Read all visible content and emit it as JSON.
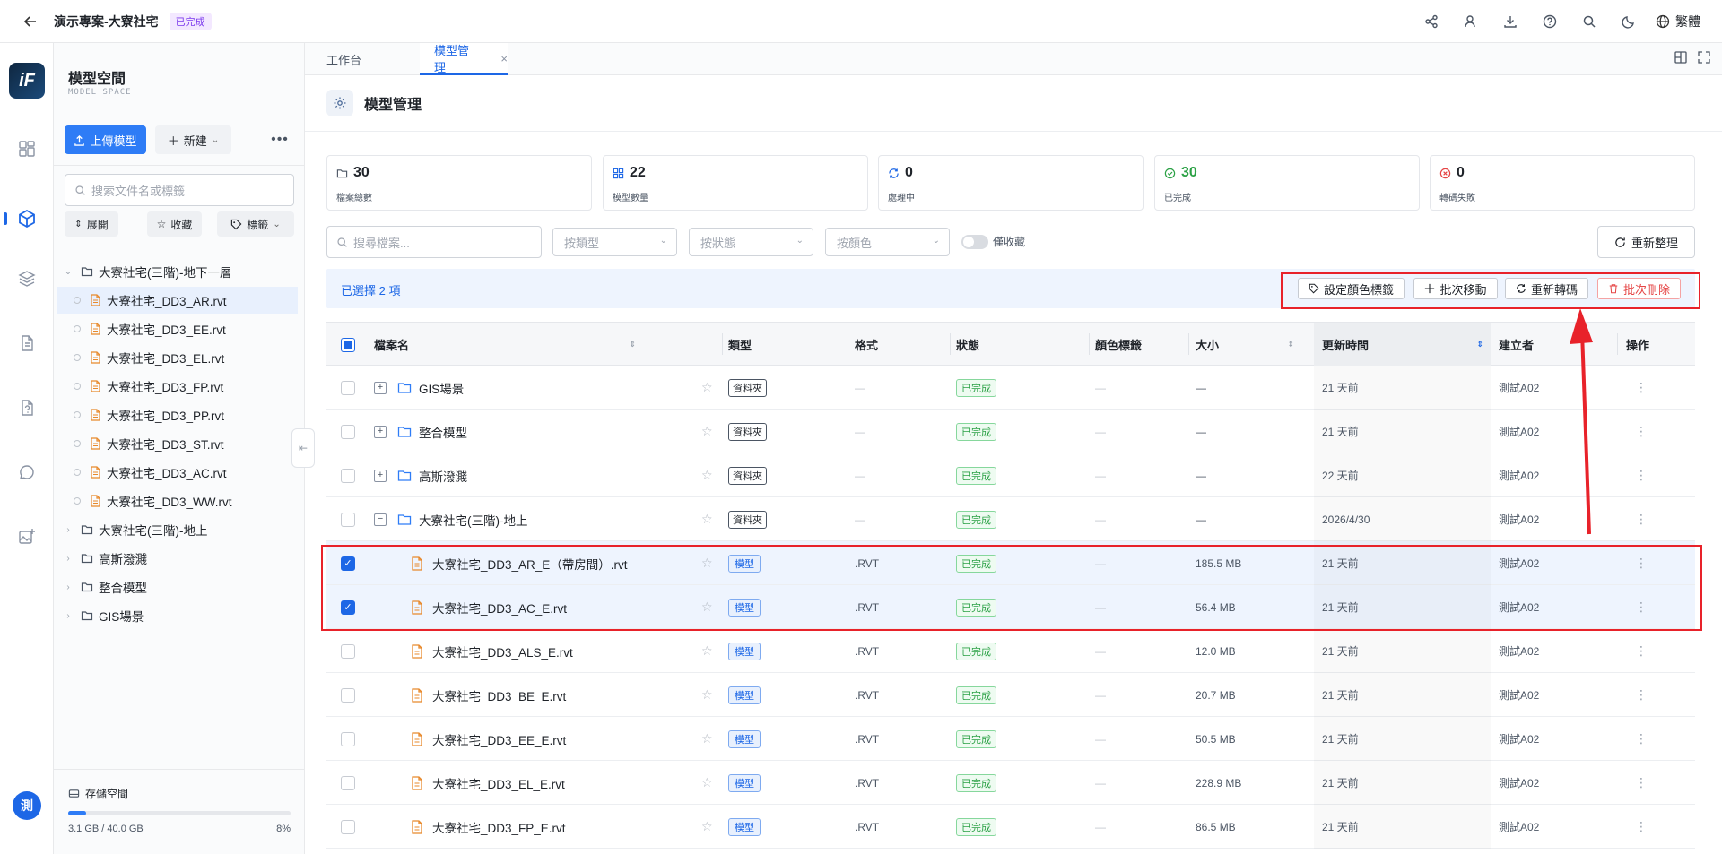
{
  "topbar": {
    "title": "演示專案-大寮社宅",
    "badge": "已完成",
    "lang": "繁體"
  },
  "rail": {
    "avatar": "測"
  },
  "sidebar": {
    "title": "模型空間",
    "subtitle": "MODEL SPACE",
    "upload": "上傳模型",
    "new": "新建",
    "search_placeholder": "搜索文件名或標籤",
    "chips": {
      "expand": "展開",
      "favorite": "收藏",
      "tags": "標籤"
    },
    "tree": [
      {
        "label": "大寮社宅(三階)-地下一層",
        "level": 0,
        "expanded": true,
        "type": "folder"
      },
      {
        "label": "大寮社宅_DD3_AR.rvt",
        "level": 1,
        "type": "file",
        "selected": true
      },
      {
        "label": "大寮社宅_DD3_EE.rvt",
        "level": 1,
        "type": "file"
      },
      {
        "label": "大寮社宅_DD3_EL.rvt",
        "level": 1,
        "type": "file"
      },
      {
        "label": "大寮社宅_DD3_FP.rvt",
        "level": 1,
        "type": "file"
      },
      {
        "label": "大寮社宅_DD3_PP.rvt",
        "level": 1,
        "type": "file"
      },
      {
        "label": "大寮社宅_DD3_ST.rvt",
        "level": 1,
        "type": "file"
      },
      {
        "label": "大寮社宅_DD3_AC.rvt",
        "level": 1,
        "type": "file"
      },
      {
        "label": "大寮社宅_DD3_WW.rvt",
        "level": 1,
        "type": "file"
      },
      {
        "label": "大寮社宅(三階)-地上",
        "level": 0,
        "expanded": false,
        "type": "folder"
      },
      {
        "label": "高斯潑濺",
        "level": 0,
        "expanded": false,
        "type": "folder"
      },
      {
        "label": "整合模型",
        "level": 0,
        "expanded": false,
        "type": "folder"
      },
      {
        "label": "GIS場景",
        "level": 0,
        "expanded": false,
        "type": "folder"
      }
    ],
    "storage": {
      "label": "存儲空間",
      "used": "3.1 GB / 40.0 GB",
      "percent": "8%",
      "fraction": 0.08
    }
  },
  "tabs": [
    {
      "label": "工作台",
      "active": false
    },
    {
      "label": "模型管理",
      "active": true
    }
  ],
  "page": {
    "title": "模型管理"
  },
  "stats": [
    {
      "value": "30",
      "label": "檔案總數",
      "icon": "folder-icon",
      "color": "#1f2329"
    },
    {
      "value": "22",
      "label": "模型數量",
      "icon": "grid-icon",
      "color": "#1f2329"
    },
    {
      "value": "0",
      "label": "處理中",
      "icon": "sync-icon",
      "color": "#1f2329"
    },
    {
      "value": "30",
      "label": "已完成",
      "icon": "check-circle-icon",
      "color": "#2ba145"
    },
    {
      "value": "0",
      "label": "轉碼失敗",
      "icon": "error-circle-icon",
      "color": "#1f2329"
    }
  ],
  "filters": {
    "search_placeholder": "搜尋檔案...",
    "type": "按類型",
    "status": "按狀態",
    "color": "按顏色",
    "favorites_only": "僅收藏",
    "refresh": "重新整理"
  },
  "selection": {
    "text": "已選擇 2 項",
    "actions": {
      "color_tag": "設定顏色標籤",
      "move": "批次移動",
      "retranscode": "重新轉碼",
      "delete": "批次刪除"
    }
  },
  "table": {
    "headers": {
      "name": "檔案名",
      "type": "類型",
      "format": "格式",
      "status": "狀態",
      "color": "顏色標籤",
      "size": "大小",
      "updated": "更新時間",
      "creator": "建立者",
      "ops": "操作"
    },
    "rows": [
      {
        "name": "GIS場景",
        "kind": "folder",
        "expand": "+",
        "type": "資料夾",
        "format": "—",
        "status": "已完成",
        "color": "—",
        "size": "—",
        "updated": "21 天前",
        "creator": "測試A02",
        "checked": false,
        "indent": 0
      },
      {
        "name": "整合模型",
        "kind": "folder",
        "expand": "+",
        "type": "資料夾",
        "format": "—",
        "status": "已完成",
        "color": "—",
        "size": "—",
        "updated": "21 天前",
        "creator": "測試A02",
        "checked": false,
        "indent": 0
      },
      {
        "name": "高斯潑濺",
        "kind": "folder",
        "expand": "+",
        "type": "資料夾",
        "format": "—",
        "status": "已完成",
        "color": "—",
        "size": "—",
        "updated": "22 天前",
        "creator": "測試A02",
        "checked": false,
        "indent": 0
      },
      {
        "name": "大寮社宅(三階)-地上",
        "kind": "folder",
        "expand": "−",
        "type": "資料夾",
        "format": "—",
        "status": "已完成",
        "color": "—",
        "size": "—",
        "updated": "2026/4/30",
        "creator": "測試A02",
        "checked": false,
        "indent": 0
      },
      {
        "name": "大寮社宅_DD3_AR_E（帶房間）.rvt",
        "kind": "file",
        "type": "模型",
        "format": ".RVT",
        "status": "已完成",
        "color": "—",
        "size": "185.5 MB",
        "updated": "21 天前",
        "creator": "測試A02",
        "checked": true,
        "indent": 1
      },
      {
        "name": "大寮社宅_DD3_AC_E.rvt",
        "kind": "file",
        "type": "模型",
        "format": ".RVT",
        "status": "已完成",
        "color": "—",
        "size": "56.4 MB",
        "updated": "21 天前",
        "creator": "測試A02",
        "checked": true,
        "indent": 1
      },
      {
        "name": "大寮社宅_DD3_ALS_E.rvt",
        "kind": "file",
        "type": "模型",
        "format": ".RVT",
        "status": "已完成",
        "color": "—",
        "size": "12.0 MB",
        "updated": "21 天前",
        "creator": "測試A02",
        "checked": false,
        "indent": 1
      },
      {
        "name": "大寮社宅_DD3_BE_E.rvt",
        "kind": "file",
        "type": "模型",
        "format": ".RVT",
        "status": "已完成",
        "color": "—",
        "size": "20.7 MB",
        "updated": "21 天前",
        "creator": "測試A02",
        "checked": false,
        "indent": 1
      },
      {
        "name": "大寮社宅_DD3_EE_E.rvt",
        "kind": "file",
        "type": "模型",
        "format": ".RVT",
        "status": "已完成",
        "color": "—",
        "size": "50.5 MB",
        "updated": "21 天前",
        "creator": "測試A02",
        "checked": false,
        "indent": 1
      },
      {
        "name": "大寮社宅_DD3_EL_E.rvt",
        "kind": "file",
        "type": "模型",
        "format": ".RVT",
        "status": "已完成",
        "color": "—",
        "size": "228.9 MB",
        "updated": "21 天前",
        "creator": "測試A02",
        "checked": false,
        "indent": 1
      },
      {
        "name": "大寮社宅_DD3_FP_E.rvt",
        "kind": "file",
        "type": "模型",
        "format": ".RVT",
        "status": "已完成",
        "color": "—",
        "size": "86.5 MB",
        "updated": "21 天前",
        "creator": "測試A02",
        "checked": false,
        "indent": 1
      }
    ]
  },
  "colors": {
    "accent": "#1d67e6",
    "success": "#2ba145",
    "danger": "#e54545",
    "highlight": "#e8222a"
  }
}
